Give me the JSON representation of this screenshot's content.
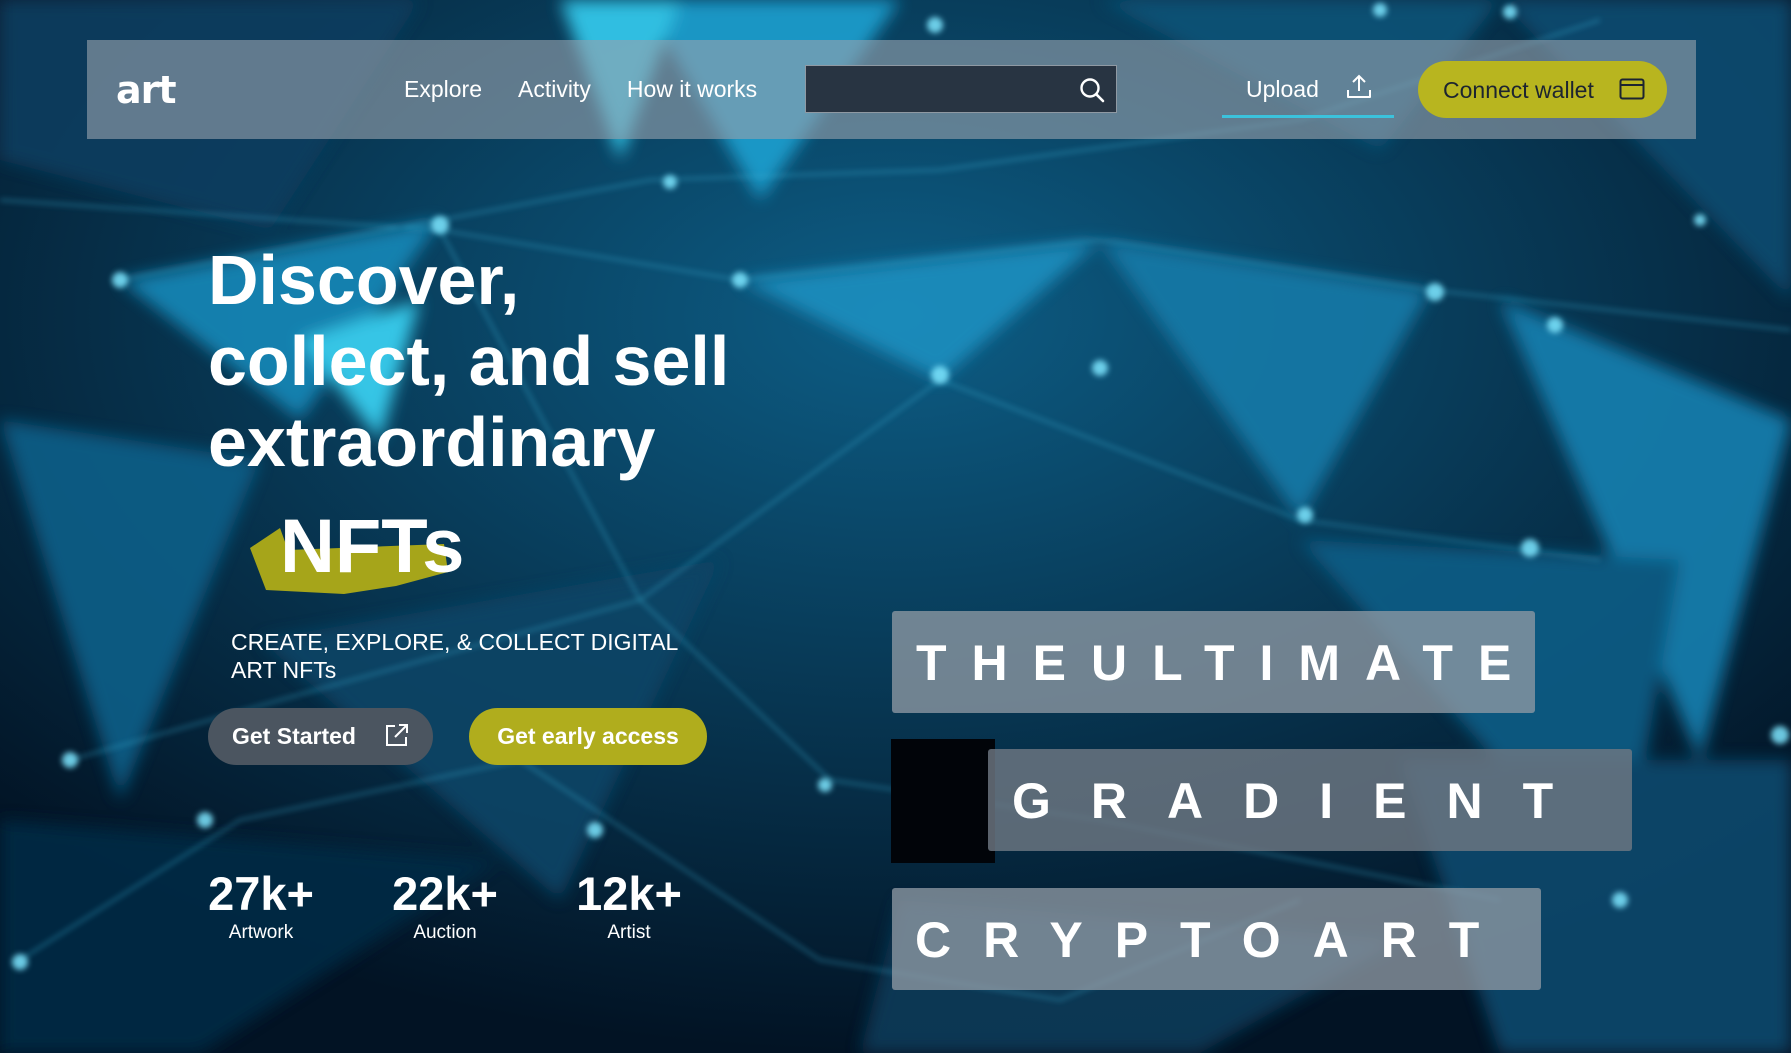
{
  "header": {
    "logo": "art",
    "nav": [
      "Explore",
      "Activity",
      "How it works"
    ],
    "search": {
      "value": "",
      "placeholder": ""
    },
    "upload_label": "Upload",
    "connect_label": "Connect wallet"
  },
  "hero": {
    "headline": [
      "Discover,",
      "collect, and sell",
      "extraordinary"
    ],
    "highlight": "NFTs",
    "subtitle_lines": [
      "CREATE, EXPLORE, & COLLECT DIGITAL",
      "ART NFTs"
    ],
    "get_started_label": "Get Started",
    "early_access_label": "Get early access"
  },
  "stats": [
    {
      "value": "27k+",
      "label": "Artwork"
    },
    {
      "value": "22k+",
      "label": "Auction"
    },
    {
      "value": "12k+",
      "label": "Artist"
    }
  ],
  "tiles": [
    "THEULTIMATE",
    "GRADIENT",
    "CRYPTOART"
  ],
  "colors": {
    "accent": "#b8b51f",
    "underline": "#3bc2dc",
    "background": "#031a2e"
  },
  "icons": {
    "search": "search-icon",
    "upload": "upload-icon",
    "wallet": "wallet-icon",
    "external": "external-link-icon"
  }
}
